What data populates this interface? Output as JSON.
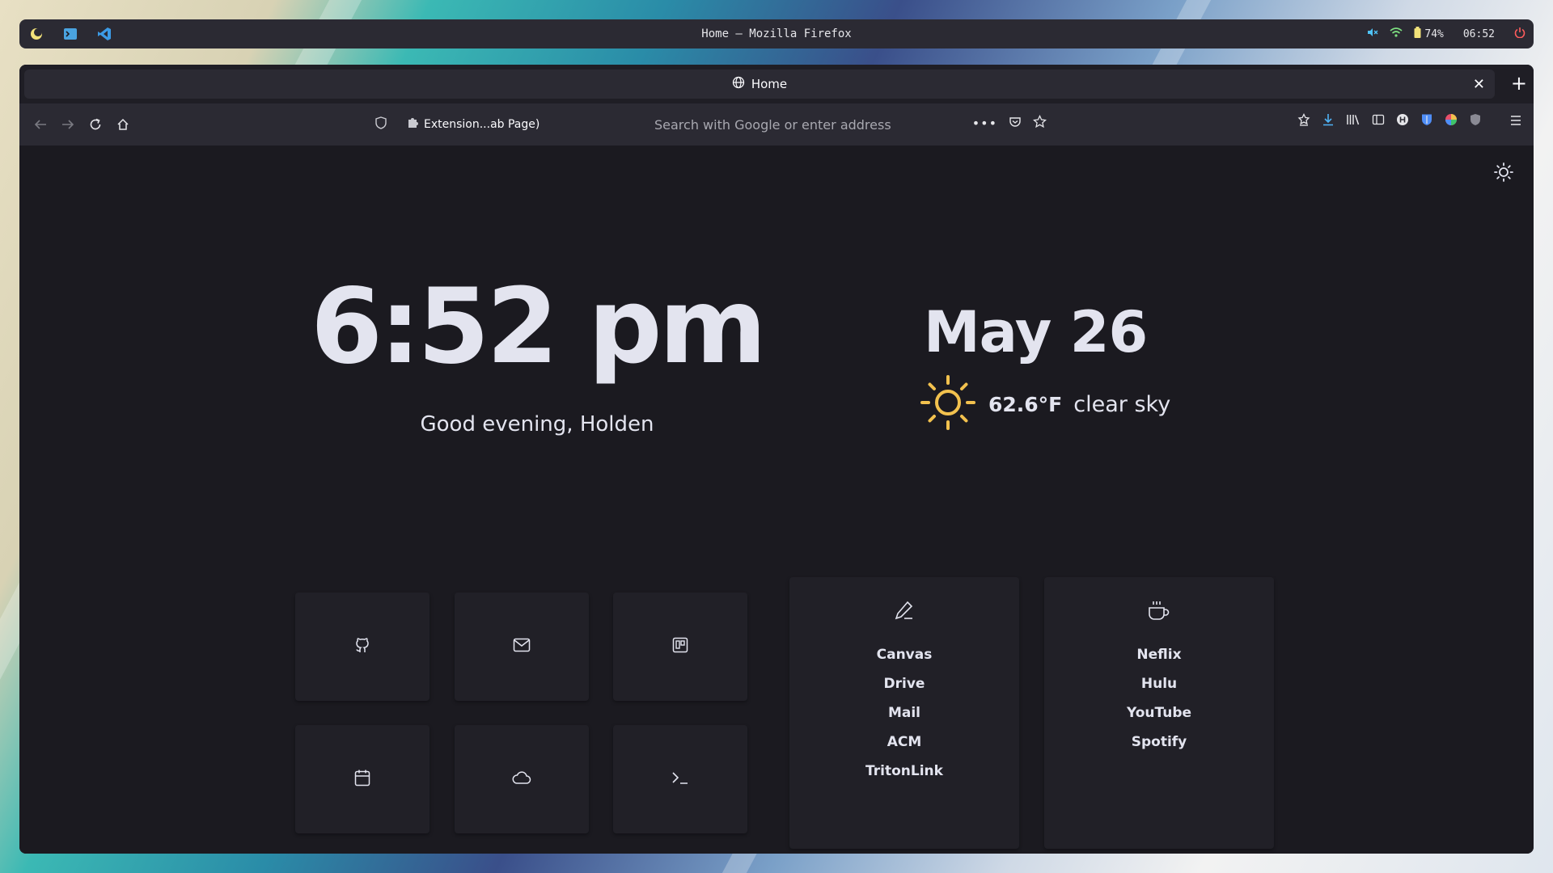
{
  "system_bar": {
    "window_title": "Home — Mozilla Firefox",
    "battery": "74%",
    "time": "06:52",
    "workspace_icons": [
      "moon-icon",
      "terminal-icon",
      "vscode-icon"
    ],
    "status_icons": [
      "mute-icon",
      "wifi-icon",
      "battery-icon",
      "power-icon"
    ]
  },
  "browser": {
    "tab_title": "Home",
    "extension_label": "Extension...ab Page)",
    "address_placeholder": "Search with Google or enter address"
  },
  "page": {
    "time": "6:52 pm",
    "greeting": "Good evening, Holden",
    "date": "May 26",
    "temperature": "62.6°F",
    "condition": "clear sky",
    "tiles": [
      {
        "icon": "github-icon"
      },
      {
        "icon": "mail-icon"
      },
      {
        "icon": "trello-icon"
      },
      {
        "icon": "calendar-icon"
      },
      {
        "icon": "cloud-icon"
      },
      {
        "icon": "terminal-icon"
      }
    ],
    "lists": [
      {
        "icon": "pencil-icon",
        "links": [
          "Canvas",
          "Drive",
          "Mail",
          "ACM",
          "TritonLink"
        ]
      },
      {
        "icon": "coffee-icon",
        "links": [
          "Neflix",
          "Hulu",
          "YouTube",
          "Spotify"
        ]
      }
    ]
  },
  "colors": {
    "accent_sun": "#f2c14e",
    "text": "#e3e4ef",
    "panel": "#212027",
    "background": "#1b1a20"
  }
}
